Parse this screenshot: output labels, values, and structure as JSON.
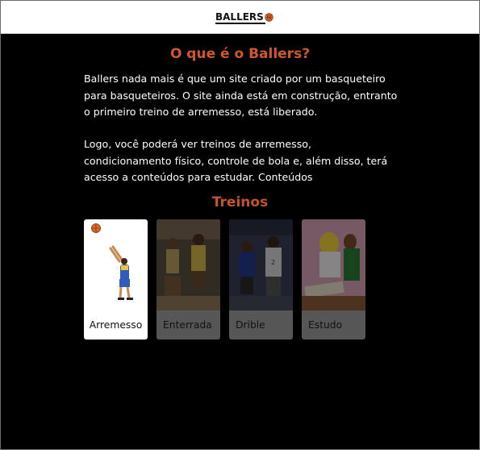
{
  "header": {
    "logo_text": "BALLERS",
    "logo_icon": "basketball-icon"
  },
  "main": {
    "title": "O que é o Ballers?",
    "paragraph1": "Ballers nada mais é que um site criado por um basqueteiro para basqueteiros. O site ainda está em construção, entranto o primeiro treino de arremesso, está liberado.",
    "paragraph2": "Logo, você poderá ver treinos de arremesso, condicionamento físico, controle de bola e, além disso, terá acesso a conteúdos para estudar. Conteúdos",
    "trainings_title": "Treinos"
  },
  "cards": [
    {
      "label": "Arremesso",
      "state": "active"
    },
    {
      "label": "Enterrada",
      "state": "disabled"
    },
    {
      "label": "Drible",
      "state": "disabled"
    },
    {
      "label": "Estudo",
      "state": "disabled"
    }
  ],
  "colors": {
    "accent": "#d2582c",
    "background": "#000000",
    "card_inactive": "#565656"
  }
}
